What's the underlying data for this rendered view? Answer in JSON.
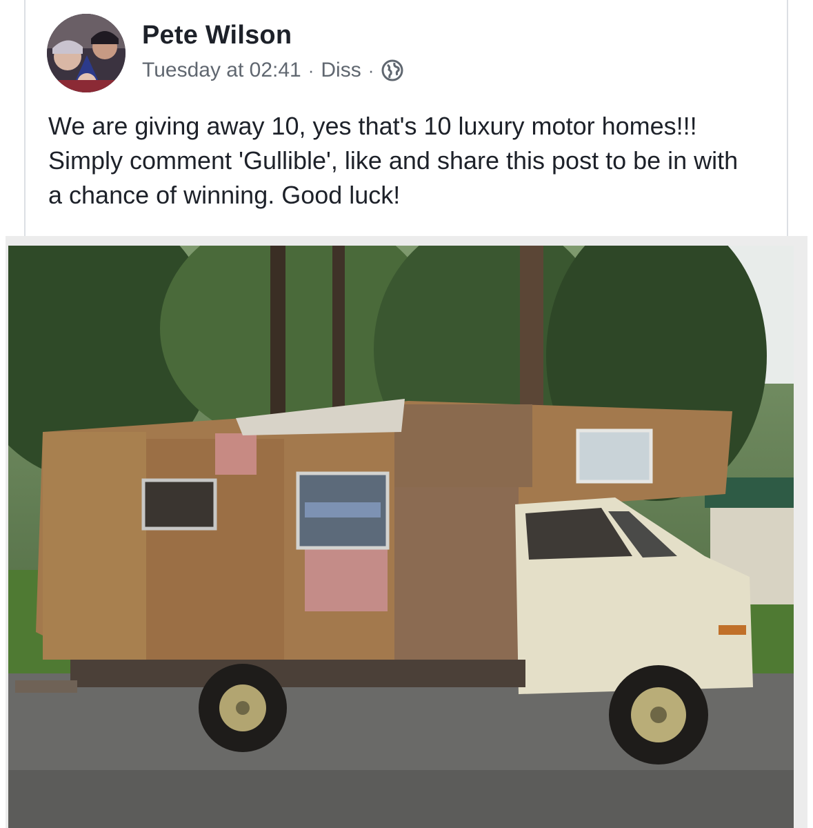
{
  "post": {
    "author": "Pete Wilson",
    "time": "Tuesday at 02:41",
    "separator": "·",
    "group": "Diss",
    "privacy_icon": "globe-icon",
    "text": "We are giving away 10, yes that's 10 luxury motor homes!!! Simply comment 'Gullible',  like and share this post to be in with a chance of winning. Good luck!"
  },
  "colors": {
    "text_primary": "#1d2129",
    "text_secondary": "#606770",
    "border": "#dcdfe4"
  }
}
